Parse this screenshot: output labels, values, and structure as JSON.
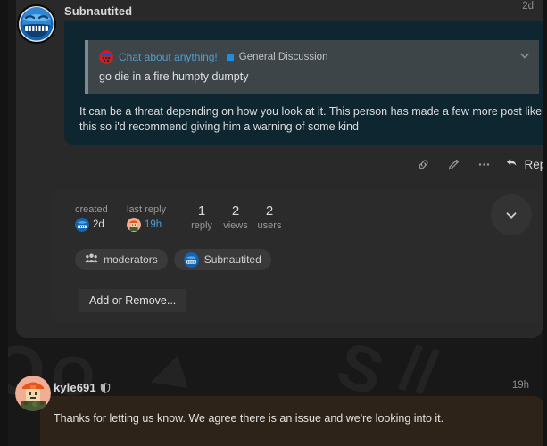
{
  "posts": [
    {
      "author": "Subnautited",
      "timestamp": "2d",
      "quote": {
        "topic_title": "Chat about anything!",
        "category": "General Discussion",
        "category_color": "#1f8ce0",
        "text": "go die in a fire humpty dumpty",
        "collapse_icon": "chevron-down-icon"
      },
      "body": "It can be a threat depending on how you look at it. This person has made a few more post like this so i'd recommend giving him a warning of some kind",
      "actions": {
        "link_icon": "link-icon",
        "edit_icon": "pencil-icon",
        "more_icon": "ellipsis-icon",
        "reply_icon": "reply-arrow-icon",
        "reply_label": "Reply"
      }
    },
    {
      "author": "kyle691",
      "badge_icon": "shield-icon",
      "timestamp": "19h",
      "body": "Thanks for letting us know. We agree there is an issue and we're looking into it."
    }
  ],
  "topic_map": {
    "created": {
      "label": "created",
      "value": "2d"
    },
    "last_reply": {
      "label": "last reply",
      "value": "19h"
    },
    "counts": [
      {
        "value": "1",
        "label": "reply"
      },
      {
        "value": "2",
        "label": "views"
      },
      {
        "value": "2",
        "label": "users"
      }
    ],
    "participants": [
      {
        "label": "moderators",
        "icon": "group-icon"
      },
      {
        "label": "Subnautited",
        "icon": "avatar"
      }
    ],
    "add_remove_label": "Add or Remove...",
    "expand_icon": "chevron-down-icon"
  },
  "colors": {
    "page_bg": "#181818",
    "post_bg": "#292929",
    "cooked_bg": "#0d2630",
    "quote_bg": "#3d4548",
    "link": "#4a9fd8",
    "staff_bubble": "#2d2318"
  }
}
